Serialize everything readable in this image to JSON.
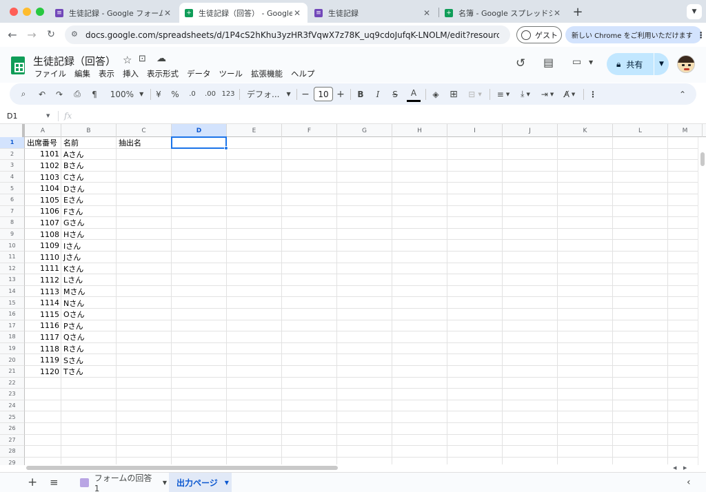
{
  "browser": {
    "tabs": [
      {
        "title": "生徒記録 - Google フォーム",
        "icon": "google-forms-icon",
        "active": false
      },
      {
        "title": "生徒記録（回答） - Google スプ",
        "icon": "google-sheets-icon",
        "active": true
      },
      {
        "title": "生徒記録",
        "icon": "google-forms-icon",
        "active": false
      },
      {
        "title": "名簿 - Google スプレッドシート",
        "icon": "google-sheets-icon",
        "active": false
      }
    ],
    "new_tab": "+",
    "url": "docs.google.com/spreadsheets/d/1P4cS2hKhu3yzHR3fVqwX7z78K_uq9cdoJufqK-LNOLM/edit?resourcekey=&gi...",
    "guest_label": "ゲスト",
    "promo_label": "新しい Chrome をご利用いただけます"
  },
  "doc": {
    "title": "生徒記録（回答）",
    "menus": [
      "ファイル",
      "編集",
      "表示",
      "挿入",
      "表示形式",
      "データ",
      "ツール",
      "拡張機能",
      "ヘルプ"
    ],
    "share_label": "共有"
  },
  "toolbar": {
    "zoom": "100%",
    "currency": "¥",
    "percent": "%",
    "decrease_decimal": ".0",
    "increase_decimal": ".00",
    "number_format": "123",
    "font": "デフォ...",
    "font_size": "10",
    "bold": "B",
    "italic": "I",
    "strike": "S",
    "text_color": "A"
  },
  "formula_bar": {
    "cell_ref": "D1",
    "fx": "fx",
    "value": ""
  },
  "sheet": {
    "columns": [
      "A",
      "B",
      "C",
      "D",
      "E",
      "F",
      "G",
      "H",
      "I",
      "J",
      "K",
      "L",
      "M"
    ],
    "selected_column": "D",
    "selected_row": 1,
    "row_numbers": [
      "1",
      "2",
      "3",
      "4",
      "5",
      "6",
      "7",
      "8",
      "9",
      "10",
      "11",
      "12",
      "13",
      "14",
      "15",
      "16",
      "17",
      "18",
      "19",
      "20",
      "21",
      "22",
      "23",
      "24",
      "25",
      "26",
      "27",
      "28",
      "29"
    ],
    "header_row": [
      "出席番号",
      "名前",
      "抽出名"
    ],
    "rows": [
      [
        "1101",
        "Aさん"
      ],
      [
        "1102",
        "Bさん"
      ],
      [
        "1103",
        "Cさん"
      ],
      [
        "1104",
        "Dさん"
      ],
      [
        "1105",
        "Eさん"
      ],
      [
        "1106",
        "Fさん"
      ],
      [
        "1107",
        "Gさん"
      ],
      [
        "1108",
        "Hさん"
      ],
      [
        "1109",
        "Iさん"
      ],
      [
        "1110",
        "Jさん"
      ],
      [
        "1111",
        "Kさん"
      ],
      [
        "1112",
        "Lさん"
      ],
      [
        "1113",
        "Mさん"
      ],
      [
        "1114",
        "Nさん"
      ],
      [
        "1115",
        "Oさん"
      ],
      [
        "1116",
        "Pさん"
      ],
      [
        "1117",
        "Qさん"
      ],
      [
        "1118",
        "Rさん"
      ],
      [
        "1119",
        "Sさん"
      ],
      [
        "1120",
        "Tさん"
      ]
    ]
  },
  "sheet_tabs": [
    {
      "label": "フォームの回答 1",
      "active": false
    },
    {
      "label": "出力ページ",
      "active": true
    }
  ],
  "colors": {
    "accent": "#1a73e8",
    "sheets_green": "#0f9d58",
    "forms_purple": "#7248b9",
    "share_bg": "#c2e7ff"
  }
}
